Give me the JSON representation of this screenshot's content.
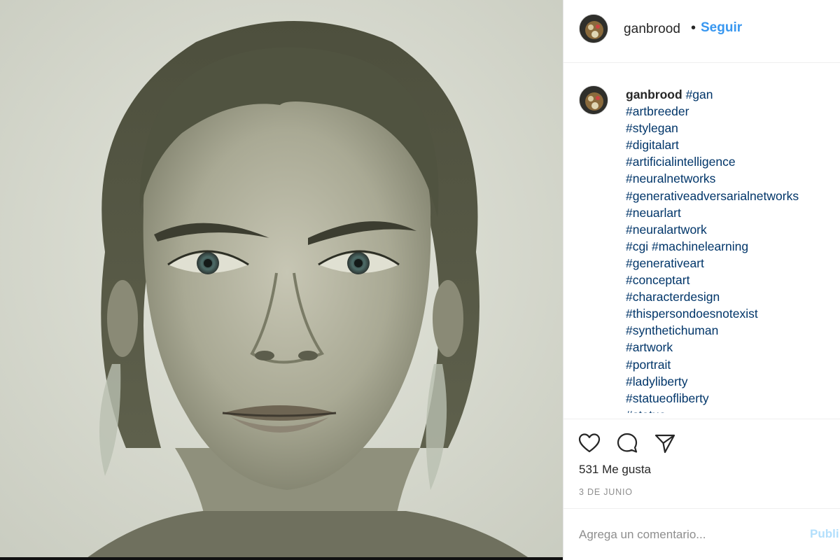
{
  "post": {
    "username": "ganbrood",
    "follow_label": "Seguir",
    "separator": "•"
  },
  "caption": {
    "username": "ganbrood",
    "first_tag": "#gan",
    "hashtags": [
      "#artbreeder",
      "#stylegan",
      "#digitalart",
      "#artificialintelligence",
      "#neuralnetworks",
      "#generativeadversarialnetworks",
      "#neuarlart",
      "#neuralartwork",
      "#cgi #machinelearning",
      "#generativeart",
      "#conceptart",
      "#characterdesign",
      "#thispersondoesnotexist",
      "#synthetichuman",
      "#artwork",
      "#portrait",
      "#ladyliberty",
      "#statueofliberty",
      "#statue"
    ]
  },
  "actions": {
    "like_icon": "heart-icon",
    "comment_icon": "speech-bubble-icon",
    "share_icon": "paper-plane-icon",
    "likes_text": "531 Me gusta",
    "date_text": "3 DE JUNIO"
  },
  "comment": {
    "placeholder": "Agrega un comentario...",
    "publish_label": "Publi"
  },
  "colors": {
    "follow": "#3897f0",
    "hashtag": "#003569",
    "muted": "#8e8e8e",
    "publish_disabled": "#b2dffc"
  }
}
